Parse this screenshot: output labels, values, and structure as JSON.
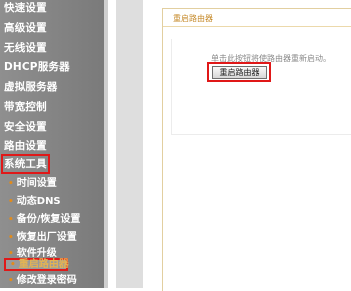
{
  "sidebar": {
    "items": [
      {
        "label": "快速设置"
      },
      {
        "label": "高级设置"
      },
      {
        "label": "无线设置"
      },
      {
        "label": "DHCP服务器"
      },
      {
        "label": "虚拟服务器"
      },
      {
        "label": "带宽控制"
      },
      {
        "label": "安全设置"
      },
      {
        "label": "路由设置"
      },
      {
        "label": "系统工具"
      }
    ],
    "subitems": [
      {
        "label": "时间设置"
      },
      {
        "label": "动态DNS"
      },
      {
        "label": "备份/恢复设置"
      },
      {
        "label": "恢复出厂设置"
      },
      {
        "label": "软件升级"
      },
      {
        "label": "重启路由器"
      },
      {
        "label": "修改登录密码"
      }
    ]
  },
  "content": {
    "title": "重启路由器",
    "description": "单击此按钮将使路由器重新启动。",
    "reboot_button": "重启路由器"
  },
  "colors": {
    "sidebar_bg": "#8a8a8a",
    "highlight_border": "#e01818",
    "bullet": "#e08b1d",
    "title_text": "#c68a2a"
  }
}
